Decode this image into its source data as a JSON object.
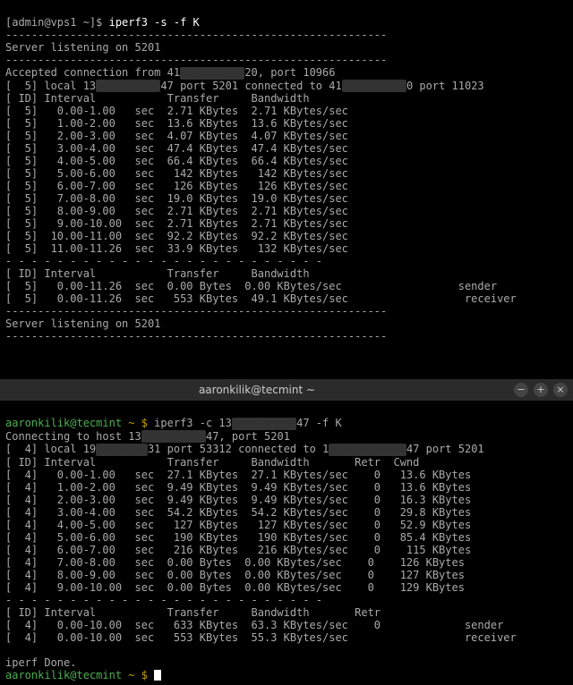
{
  "server": {
    "prompt": "[admin@vps1 ~]$",
    "command": "iperf3 -s -f K",
    "listening1": "Server listening on 5201",
    "divider1": "-----------------------------------------------------------",
    "accepted_prefix": "Accepted connection from 41",
    "accepted_suffix": "20, port 10966",
    "conn_prefix": "[  5] local 13",
    "conn_mid": "47 port 5201 connected to 41",
    "conn_suffix": "0 port 11023",
    "header": "[ ID] Interval           Transfer     Bandwidth",
    "rows": [
      "[  5]   0.00-1.00   sec  2.71 KBytes  2.71 KBytes/sec",
      "[  5]   1.00-2.00   sec  13.6 KBytes  13.6 KBytes/sec",
      "[  5]   2.00-3.00   sec  4.07 KBytes  4.07 KBytes/sec",
      "[  5]   3.00-4.00   sec  47.4 KBytes  47.4 KBytes/sec",
      "[  5]   4.00-5.00   sec  66.4 KBytes  66.4 KBytes/sec",
      "[  5]   5.00-6.00   sec   142 KBytes   142 KBytes/sec",
      "[  5]   6.00-7.00   sec   126 KBytes   126 KBytes/sec",
      "[  5]   7.00-8.00   sec  19.0 KBytes  19.0 KBytes/sec",
      "[  5]   8.00-9.00   sec  2.71 KBytes  2.71 KBytes/sec",
      "[  5]   9.00-10.00  sec  2.71 KBytes  2.71 KBytes/sec",
      "[  5]  10.00-11.00  sec  92.2 KBytes  92.2 KBytes/sec",
      "[  5]  11.00-11.26  sec  33.9 KBytes   132 KBytes/sec"
    ],
    "dash": "- - - - - - - - - - - - - - - - - - - - - - - - -",
    "summary_header": "[ ID] Interval           Transfer     Bandwidth",
    "summary_rows": [
      "[  5]   0.00-11.26  sec  0.00 Bytes  0.00 KBytes/sec                  sender",
      "[  5]   0.00-11.26  sec   553 KBytes  49.1 KBytes/sec                  receiver"
    ],
    "divider2": "-----------------------------------------------------------",
    "listening2": "Server listening on 5201"
  },
  "client": {
    "window_title": "aaronkilik@tecmint ~",
    "user": "aaronkilik@tecmint",
    "path": " ~ $ ",
    "cmd_prefix": "iperf3 -c 13",
    "cmd_suffix": "47 -f K",
    "connecting_prefix": "Connecting to host 13",
    "connecting_suffix": "47, port 5201",
    "conn_prefix": "[  4] local 19",
    "conn_mid": "31 port 53312 connected to 1",
    "conn_suffix": "47 port 5201",
    "header": "[ ID] Interval           Transfer     Bandwidth       Retr  Cwnd",
    "rows": [
      "[  4]   0.00-1.00   sec  27.1 KBytes  27.1 KBytes/sec    0   13.6 KBytes",
      "[  4]   1.00-2.00   sec  9.49 KBytes  9.49 KBytes/sec    0   13.6 KBytes",
      "[  4]   2.00-3.00   sec  9.49 KBytes  9.49 KBytes/sec    0   16.3 KBytes",
      "[  4]   3.00-4.00   sec  54.2 KBytes  54.2 KBytes/sec    0   29.8 KBytes",
      "[  4]   4.00-5.00   sec   127 KBytes   127 KBytes/sec    0   52.9 KBytes",
      "[  4]   5.00-6.00   sec   190 KBytes   190 KBytes/sec    0   85.4 KBytes",
      "[  4]   6.00-7.00   sec   216 KBytes   216 KBytes/sec    0    115 KBytes",
      "[  4]   7.00-8.00   sec  0.00 Bytes  0.00 KBytes/sec    0    126 KBytes",
      "[  4]   8.00-9.00   sec  0.00 Bytes  0.00 KBytes/sec    0    127 KBytes",
      "[  4]   9.00-10.00  sec  0.00 Bytes  0.00 KBytes/sec    0    129 KBytes"
    ],
    "dash": "- - - - - - - - - - - - - - - - - - - - - - - - -",
    "summary_header": "[ ID] Interval           Transfer     Bandwidth       Retr",
    "summary_rows": [
      "[  4]   0.00-10.00  sec   633 KBytes  63.3 KBytes/sec    0             sender",
      "[  4]   0.00-10.00  sec   553 KBytes  55.3 KBytes/sec                  receiver"
    ],
    "done": "iperf Done."
  }
}
